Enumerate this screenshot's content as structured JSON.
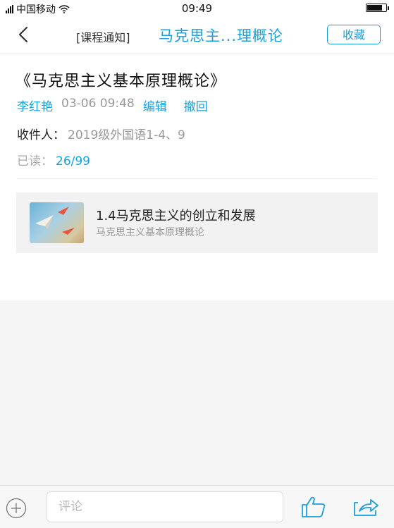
{
  "status_bar": {
    "carrier": "中国移动",
    "time": "09:49",
    "battery_level": 0.85
  },
  "nav": {
    "tag": "[课程通知]",
    "title": "马克思主...理概论",
    "favorite_label": "收藏"
  },
  "notice": {
    "title": "《马克思主义基本原理概论》",
    "author": "李红艳",
    "date": "03-06 09:48",
    "edit_label": "编辑",
    "recall_label": "撤回",
    "recipients_label": "收件人：",
    "recipients_value": "2019级外国语1-4、9",
    "read_label": "已读：",
    "read_value": "26/99"
  },
  "attachment": {
    "title": "1.4马克思主义的创立和发展",
    "subtitle": "马克思主义基本原理概论"
  },
  "bottom_bar": {
    "comment_placeholder": "评论"
  },
  "colors": {
    "accent": "#1aa0d8",
    "muted": "#999999"
  },
  "icons": [
    "signal-icon",
    "wifi-icon",
    "battery-icon",
    "back-arrow-icon",
    "plus-icon",
    "thumbs-up-icon",
    "share-icon"
  ]
}
